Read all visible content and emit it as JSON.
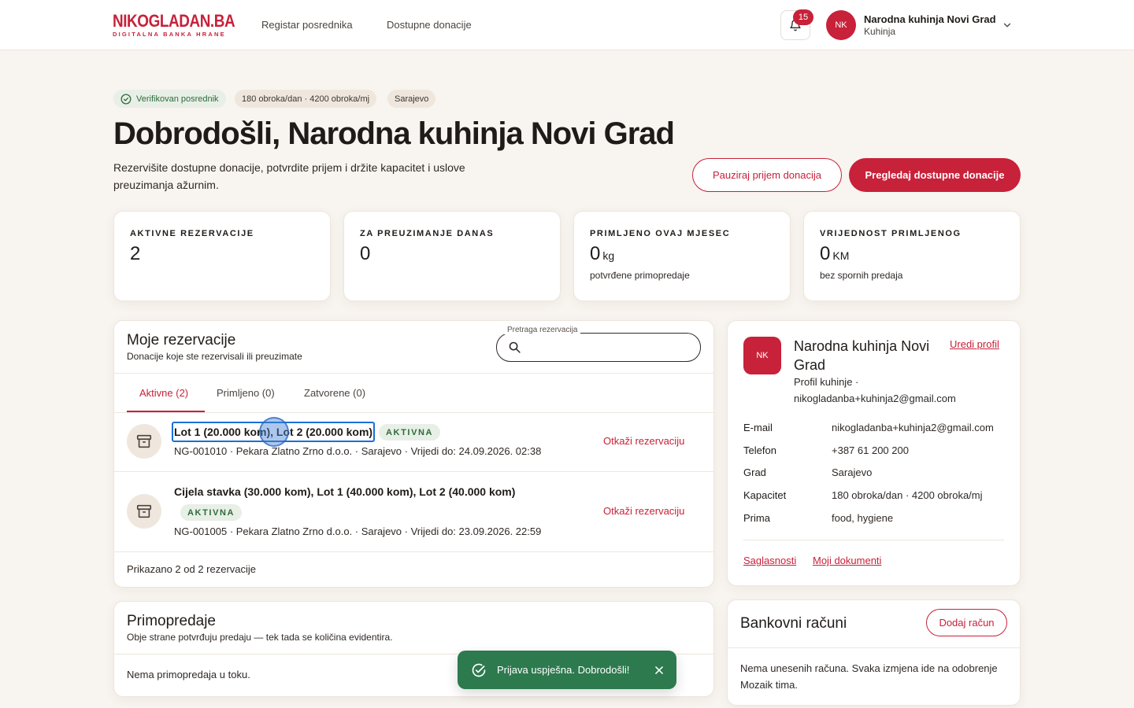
{
  "brand": {
    "name": "NIKOGLADAN.BA",
    "tagline": "DIGITALNA BANKA HRANE",
    "accent": "#c8213a"
  },
  "nav": {
    "items": [
      "Registar posrednika",
      "Dostupne donacije"
    ]
  },
  "notifications": {
    "count": "15"
  },
  "user": {
    "initials": "NK",
    "name": "Narodna kuhinja Novi Grad",
    "role": "Kuhinja"
  },
  "hero": {
    "badges": [
      "Verifikovan posrednik",
      "180 obroka/dan · 4200 obroka/mj",
      "Sarajevo"
    ],
    "title": "Dobrodošli, Narodna kuhinja Novi Grad",
    "subtitle": "Rezervišite dostupne donacije, potvrdite prijem i držite kapacitet i uslove preuzimanja ažurnim.",
    "pause_label": "Pauziraj prijem donacija",
    "browse_label": "Pregledaj dostupne donacije"
  },
  "stats": [
    {
      "label": "AKTIVNE REZERVACIJE",
      "value": "2",
      "unit": "",
      "note": ""
    },
    {
      "label": "ZA PREUZIMANJE DANAS",
      "value": "0",
      "unit": "",
      "note": ""
    },
    {
      "label": "PRIMLJENO OVAJ MJESEC",
      "value": "0",
      "unit": "kg",
      "note": "potvrđene primopredaje"
    },
    {
      "label": "VRIJEDNOST PRIMLJENOG",
      "value": "0",
      "unit": "KM",
      "note": "bez spornih predaja"
    }
  ],
  "reservations": {
    "title": "Moje rezervacije",
    "subtitle": "Donacije koje ste rezervisali ili preuzimate",
    "search_label": "Pretraga rezervacija",
    "search_value": "",
    "tabs": [
      "Aktivne (2)",
      "Primljeno (0)",
      "Zatvorene (0)"
    ],
    "rows": [
      {
        "title": "Lot 1 (20.000 kom), Lot 2 (20.000 kom)",
        "status": "AKTIVNA",
        "meta": "NG-001010 · Pekara Zlatno Zrno d.o.o. · Sarajevo · Vrijedi do: 24.09.2026. 02:38",
        "action": "Otkaži rezervaciju"
      },
      {
        "title": "Cijela stavka (30.000 kom), Lot 1 (40.000 kom), Lot 2 (40.000 kom)",
        "status": "AKTIVNA",
        "meta": "NG-001005 · Pekara Zlatno Zrno d.o.o. · Sarajevo · Vrijedi do: 23.09.2026. 22:59",
        "action": "Otkaži rezervaciju"
      }
    ],
    "footer": "Prikazano 2 od 2 rezervacije"
  },
  "handovers": {
    "title": "Primopredaje",
    "subtitle": "Obje strane potvrđuju predaju — tek tada se količina evidentira.",
    "empty": "Nema primopredaja u toku."
  },
  "profile": {
    "initials": "NK",
    "name": "Narodna kuhinja Novi Grad",
    "subtitle": "Profil kuhinje · nikogladanba+kuhinja2@gmail.com",
    "edit_label": "Uredi profil",
    "fields": [
      {
        "label": "E-mail",
        "value": "nikogladanba+kuhinja2@gmail.com"
      },
      {
        "label": "Telefon",
        "value": "+387 61 200 200"
      },
      {
        "label": "Grad",
        "value": "Sarajevo"
      },
      {
        "label": "Kapacitet",
        "value": "180 obroka/dan · 4200 obroka/mj"
      },
      {
        "label": "Prima",
        "value": "food, hygiene"
      }
    ],
    "links": [
      "Saglasnosti",
      "Moji dokumenti"
    ]
  },
  "bank": {
    "title": "Bankovni računi",
    "add_label": "Dodaj račun",
    "empty": "Nema unesenih računa. Svaka izmjena ide na odobrenje Mozaik tima."
  },
  "toast": {
    "message": "Prijava uspješna. Dobrodošli!"
  }
}
